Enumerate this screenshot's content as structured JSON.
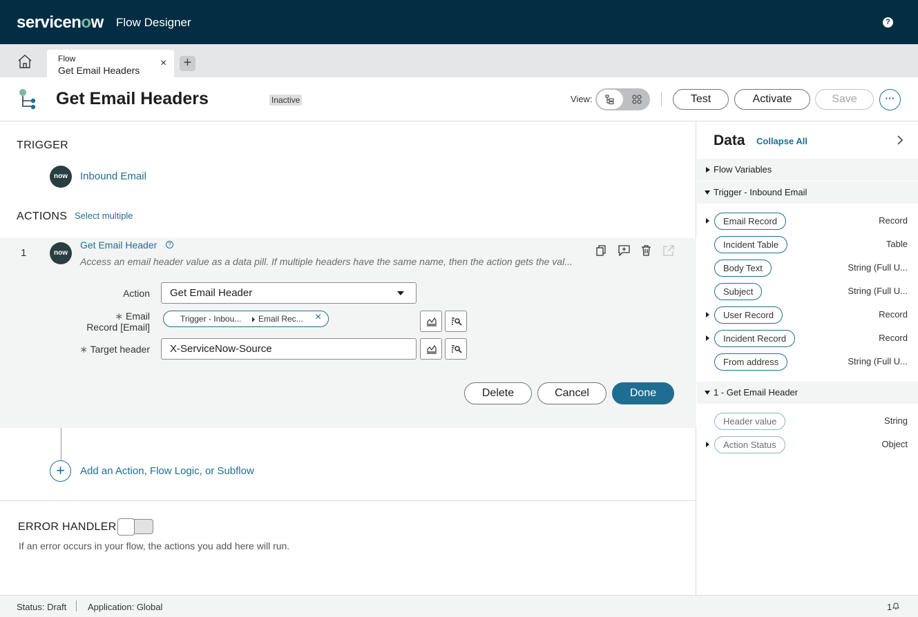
{
  "header": {
    "brand_pre": "servicen",
    "brand_o": "o",
    "brand_post": "w",
    "product": "Flow Designer",
    "help_icon": "?"
  },
  "tabs": {
    "items": [
      {
        "type": "Flow",
        "name": "Get Email Headers",
        "close": "×"
      }
    ],
    "add_label": "+"
  },
  "title_bar": {
    "title": "Get Email Headers",
    "status": "Inactive",
    "view_label": "View:",
    "buttons": {
      "test": "Test",
      "activate": "Activate",
      "save": "Save",
      "more": "···"
    }
  },
  "main": {
    "trigger_heading": "TRIGGER",
    "trigger": {
      "logo": "now",
      "label": "Inbound Email"
    },
    "actions_heading": "ACTIONS",
    "select_multiple": "Select multiple",
    "action": {
      "number": "1",
      "logo": "now",
      "name": "Get Email Header",
      "help_icon": "?",
      "description": "Access an email header value as a data pill. If multiple headers have the same name, then the action gets the val...",
      "fields": {
        "action_label": "Action",
        "action_value": "Get Email Header",
        "email_label_line1": "Email",
        "email_label_line2": "Record [Email]",
        "email_pill_part1": "Trigger - Inbou...",
        "email_pill_part2": "Email Rec...",
        "pill_remove": "×",
        "target_label": "Target header",
        "target_value": "X-ServiceNow-Source",
        "required_mark": "∗"
      },
      "buttons": {
        "delete": "Delete",
        "cancel": "Cancel",
        "done": "Done"
      }
    },
    "add_action": {
      "icon": "+",
      "label": "Add an Action, Flow Logic, or Subflow"
    },
    "error_handler": {
      "heading": "ERROR HANDLER",
      "enabled": false,
      "description": "If an error occurs in your flow, the actions you add here will run."
    }
  },
  "data_panel": {
    "title": "Data",
    "collapse_all": "Collapse All",
    "groups": [
      {
        "label": "Flow Variables",
        "expanded": false
      },
      {
        "label": "Trigger - Inbound Email",
        "expanded": true
      },
      {
        "label": "1 - Get Email Header",
        "expanded": true
      }
    ],
    "trigger_items": [
      {
        "name": "Email Record",
        "type": "Record",
        "expandable": true
      },
      {
        "name": "Incident Table",
        "type": "Table",
        "expandable": false
      },
      {
        "name": "Body Text",
        "type": "String (Full U...",
        "expandable": false
      },
      {
        "name": "Subject",
        "type": "String (Full U...",
        "expandable": false
      },
      {
        "name": "User Record",
        "type": "Record",
        "expandable": true
      },
      {
        "name": "Incident Record",
        "type": "Record",
        "expandable": true
      },
      {
        "name": "From address",
        "type": "String (Full U...",
        "expandable": false
      }
    ],
    "action_items": [
      {
        "name": "Header value",
        "type": "String",
        "expandable": false
      },
      {
        "name": "Action Status",
        "type": "Object",
        "expandable": true
      }
    ]
  },
  "status_bar": {
    "status": "Status: Draft",
    "application": "Application: Global",
    "notifications": "1"
  },
  "colors": {
    "header_bg": "#032d42",
    "accent": "#1f6e92",
    "brand_o": "#81b5a1"
  }
}
